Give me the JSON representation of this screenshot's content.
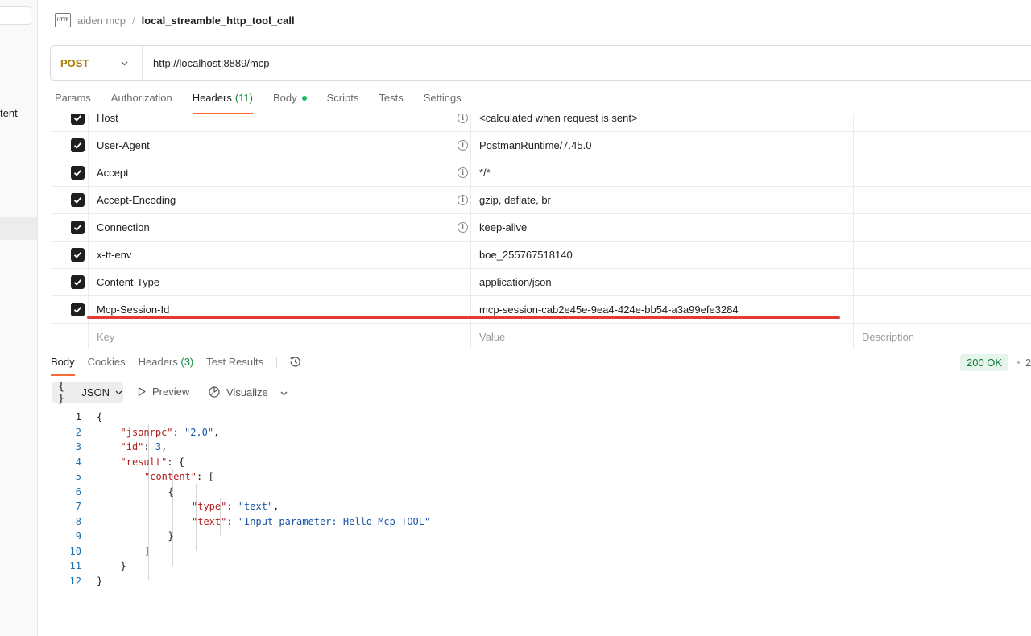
{
  "sidebar": {
    "truncated_label": "tent"
  },
  "breadcrumb": {
    "icon_text": "HTTP",
    "parent": "aiden mcp",
    "separator": "/",
    "current": "local_streamble_http_tool_call"
  },
  "request": {
    "method": "POST",
    "url": "http://localhost:8889/mcp"
  },
  "request_tabs": [
    {
      "label": "Params"
    },
    {
      "label": "Authorization"
    },
    {
      "label": "Headers",
      "count": "(11)"
    },
    {
      "label": "Body"
    },
    {
      "label": "Scripts"
    },
    {
      "label": "Tests"
    },
    {
      "label": "Settings"
    }
  ],
  "headers": [
    {
      "key": "Host",
      "value": "<calculated when request is sent>",
      "info": true
    },
    {
      "key": "User-Agent",
      "value": "PostmanRuntime/7.45.0",
      "info": true
    },
    {
      "key": "Accept",
      "value": "*/*",
      "info": true
    },
    {
      "key": "Accept-Encoding",
      "value": "gzip, deflate, br",
      "info": true
    },
    {
      "key": "Connection",
      "value": "keep-alive",
      "info": true
    },
    {
      "key": "x-tt-env",
      "value": "boe_255767518140",
      "info": false
    },
    {
      "key": "Content-Type",
      "value": "application/json",
      "info": false
    },
    {
      "key": "Mcp-Session-Id",
      "value": "mcp-session-cab2e45e-9ea4-424e-bb54-a3a99efe3284",
      "info": false
    }
  ],
  "headers_placeholder": {
    "key": "Key",
    "value": "Value",
    "description": "Description"
  },
  "response_tabs": [
    {
      "label": "Body"
    },
    {
      "label": "Cookies"
    },
    {
      "label": "Headers",
      "count": "(3)"
    },
    {
      "label": "Test Results"
    }
  ],
  "response_status": {
    "text": "200 OK",
    "more": "2"
  },
  "response_toolbar": {
    "format_braces": "{ }",
    "format": "JSON",
    "preview": "Preview",
    "visualize": "Visualize"
  },
  "code_lines": [
    {
      "n": "1",
      "tokens": [
        [
          "p",
          "{"
        ]
      ]
    },
    {
      "n": "2",
      "tokens": [
        [
          "k",
          "\"jsonrpc\""
        ],
        [
          "p",
          ": "
        ],
        [
          "s",
          "\"2.0\""
        ],
        [
          "p",
          ","
        ]
      ]
    },
    {
      "n": "3",
      "tokens": [
        [
          "k",
          "\"id\""
        ],
        [
          "p",
          ": "
        ],
        [
          "n",
          "3"
        ],
        [
          "p",
          ","
        ]
      ]
    },
    {
      "n": "4",
      "tokens": [
        [
          "k",
          "\"result\""
        ],
        [
          "p",
          ": {"
        ]
      ]
    },
    {
      "n": "5",
      "tokens": [
        [
          "k",
          "\"content\""
        ],
        [
          "p",
          ": ["
        ]
      ]
    },
    {
      "n": "6",
      "tokens": [
        [
          "p",
          "{"
        ]
      ]
    },
    {
      "n": "7",
      "tokens": [
        [
          "k",
          "\"type\""
        ],
        [
          "p",
          ": "
        ],
        [
          "s",
          "\"text\""
        ],
        [
          "p",
          ","
        ]
      ]
    },
    {
      "n": "8",
      "tokens": [
        [
          "k",
          "\"text\""
        ],
        [
          "p",
          ": "
        ],
        [
          "s",
          "\"Input parameter: Hello Mcp TOOL\""
        ]
      ]
    },
    {
      "n": "9",
      "tokens": [
        [
          "p",
          "}"
        ]
      ]
    },
    {
      "n": "10",
      "tokens": [
        [
          "p",
          "]"
        ]
      ]
    },
    {
      "n": "11",
      "tokens": [
        [
          "p",
          "}"
        ]
      ]
    },
    {
      "n": "12",
      "tokens": [
        [
          "p",
          "}"
        ]
      ]
    }
  ],
  "colors": {
    "accent": "#ff6c37",
    "method": "#ab7b00",
    "success": "#0b8a3e",
    "highlight": "#e53935"
  }
}
